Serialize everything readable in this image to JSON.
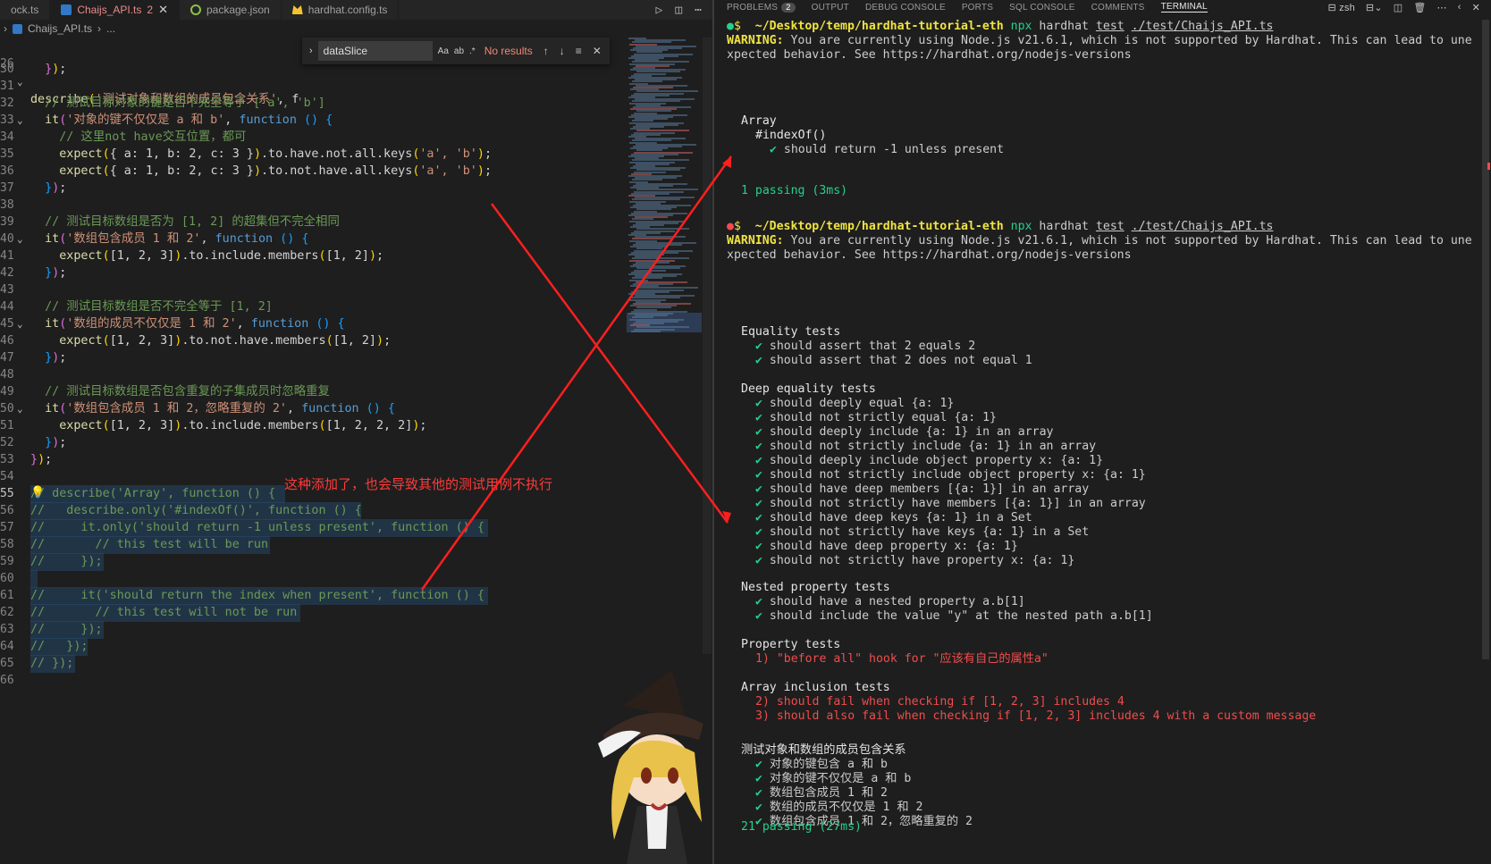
{
  "tabs": [
    {
      "label": "ock.ts",
      "active": false
    },
    {
      "label": "Chaijs_API.ts",
      "count": "2",
      "active": true
    },
    {
      "label": "package.json",
      "active": false
    },
    {
      "label": "hardhat.config.ts",
      "active": false
    }
  ],
  "breadcrumb": {
    "file": "Chaijs_API.ts",
    "more": "..."
  },
  "find": {
    "query": "dataSlice",
    "status": "No results",
    "opt_case": "Aa",
    "opt_word": "ab",
    "opt_regex": ".*"
  },
  "annotation": "这种添加了，也会导致其他的测试用例不执行",
  "code": {
    "l26": {
      "n": "26",
      "describe": "describe",
      "str": "'测试对象和数组的成员包含关系'",
      "tail": ", f"
    },
    "l30": {
      "n": "30"
    },
    "l31": {
      "n": "31"
    },
    "l32": {
      "n": "32",
      "comment": "// 测试目标对象的键是否不完全等于 ['a', 'b']"
    },
    "l33": {
      "n": "33",
      "it": "it",
      "str": "'对象的键不仅仅是 a 和 b'",
      "fn": "function"
    },
    "l34": {
      "n": "34",
      "comment": "// 这里not have交互位置，都可"
    },
    "l35": {
      "n": "35",
      "expect": "expect",
      "obj": "{ a: 1, b: 2, c: 3 }",
      "chain": ".to.have.not.all.keys",
      "args": "'a', 'b'"
    },
    "l36": {
      "n": "36",
      "expect": "expect",
      "obj": "{ a: 1, b: 2, c: 3 }",
      "chain": ".to.not.have.all.keys",
      "args": "'a', 'b'"
    },
    "l37": {
      "n": "37"
    },
    "l38": {
      "n": "38"
    },
    "l39": {
      "n": "39",
      "comment": "// 测试目标数组是否为 [1, 2] 的超集但不完全相同"
    },
    "l40": {
      "n": "40",
      "it": "it",
      "str": "'数组包含成员 1 和 2'",
      "fn": "function"
    },
    "l41": {
      "n": "41",
      "expect": "expect",
      "arr": "[1, 2, 3]",
      "chain": ".to.include.members",
      "args": "[1, 2]"
    },
    "l42": {
      "n": "42"
    },
    "l43": {
      "n": "43"
    },
    "l44": {
      "n": "44",
      "comment": "// 测试目标数组是否不完全等于 [1, 2]"
    },
    "l45": {
      "n": "45",
      "it": "it",
      "str": "'数组的成员不仅仅是 1 和 2'",
      "fn": "function"
    },
    "l46": {
      "n": "46",
      "expect": "expect",
      "arr": "[1, 2, 3]",
      "chain": ".to.not.have.members",
      "args": "[1, 2]"
    },
    "l47": {
      "n": "47"
    },
    "l48": {
      "n": "48"
    },
    "l49": {
      "n": "49",
      "comment": "// 测试目标数组是否包含重复的子集成员时忽略重复"
    },
    "l50": {
      "n": "50",
      "it": "it",
      "str": "'数组包含成员 1 和 2，忽略重复的 2'",
      "fn": "function"
    },
    "l51": {
      "n": "51",
      "expect": "expect",
      "arr": "[1, 2, 3]",
      "chain": ".to.include.members",
      "args": "[1, 2, 2, 2]"
    },
    "l52": {
      "n": "52"
    },
    "l53": {
      "n": "53"
    },
    "l54": {
      "n": "54"
    },
    "l55": {
      "n": "55",
      "text": "// describe('Array', function () {"
    },
    "l56": {
      "n": "56",
      "text": "//   describe.only('#indexOf()', function () {"
    },
    "l57": {
      "n": "57",
      "text": "//     it.only('should return -1 unless present', function () {"
    },
    "l58": {
      "n": "58",
      "text": "//       // this test will be run"
    },
    "l59": {
      "n": "59",
      "text": "//     });"
    },
    "l60": {
      "n": "60"
    },
    "l61": {
      "n": "61",
      "text": "//     it('should return the index when present', function () {"
    },
    "l62": {
      "n": "62",
      "text": "//       // this test will not be run"
    },
    "l63": {
      "n": "63",
      "text": "//     });"
    },
    "l64": {
      "n": "64",
      "text": "//   });"
    },
    "l65": {
      "n": "65",
      "text": "// });"
    },
    "l66": {
      "n": "66"
    }
  },
  "panel_tabs": [
    {
      "label": "PROBLEMS",
      "badge": "2"
    },
    {
      "label": "OUTPUT"
    },
    {
      "label": "DEBUG CONSOLE"
    },
    {
      "label": "PORTS"
    },
    {
      "label": "SQL CONSOLE"
    },
    {
      "label": "COMMENTS"
    },
    {
      "label": "TERMINAL",
      "active": true
    }
  ],
  "shell": "zsh",
  "terminal": {
    "run1": {
      "cwd": "~/Desktop/temp/hardhat-tutorial-eth",
      "cmd_npx": "npx",
      "cmd_hardhat": "hardhat",
      "cmd_test": "test",
      "cmd_file": "./test/Chaijs_API.ts",
      "warn_label": "WARNING:",
      "warn_text1": " You are currently using Node.js v21.6.1, which is not supported by Hardhat. This can lead to une",
      "warn_text2": "xpected behavior. See https://hardhat.org/nodejs-versions",
      "suite": "Array",
      "sub": "#indexOf()",
      "test": "should return -1 unless present",
      "passing": "1 passing (3ms)"
    },
    "run2": {
      "cwd": "~/Desktop/temp/hardhat-tutorial-eth",
      "cmd_npx": "npx",
      "cmd_hardhat": "hardhat",
      "cmd_test": "test",
      "cmd_file": "./test/Chaijs_API.ts",
      "warn_label": "WARNING:",
      "warn_text1": " You are currently using Node.js v21.6.1, which is not supported by Hardhat. This can lead to une",
      "warn_text2": "xpected behavior. See https://hardhat.org/nodejs-versions",
      "groups": [
        {
          "title": "Equality tests",
          "items": [
            "should assert that 2 equals 2",
            "should assert that 2 does not equal 1"
          ]
        },
        {
          "title": "Deep equality tests",
          "items": [
            "should deeply equal {a: 1}",
            "should not strictly equal {a: 1}",
            "should deeply include {a: 1} in an array",
            "should not strictly include {a: 1} in an array",
            "should deeply include object property x: {a: 1}",
            "should not strictly include object property x: {a: 1}",
            "should have deep members [{a: 1}] in an array",
            "should not strictly have members [{a: 1}] in an array",
            "should have deep keys {a: 1} in a Set",
            "should not strictly have keys {a: 1} in a Set",
            "should have deep property x: {a: 1}",
            "should not strictly have property x: {a: 1}"
          ]
        },
        {
          "title": "Nested property tests",
          "items": [
            "should have a nested property a.b[1]",
            "should include the value \"y\" at the nested path a.b[1]"
          ]
        },
        {
          "title": "Property tests",
          "fails": [
            "1) \"before all\" hook for \"应该有自己的属性a\""
          ]
        },
        {
          "title": "Array inclusion tests",
          "fails": [
            "2) should fail when checking if [1, 2, 3] includes 4",
            "3) should also fail when checking if [1, 2, 3] includes 4 with a custom message"
          ]
        },
        {
          "title": "测试对象和数组的成员包含关系",
          "items": [
            "对象的键包含 a 和 b",
            "对象的键不仅仅是 a 和 b",
            "数组包含成员 1 和 2",
            "数组的成员不仅仅是 1 和 2",
            "数组包含成员 1 和 2，忽略重复的 2"
          ]
        }
      ],
      "passing": "21 passing (27ms)"
    }
  }
}
